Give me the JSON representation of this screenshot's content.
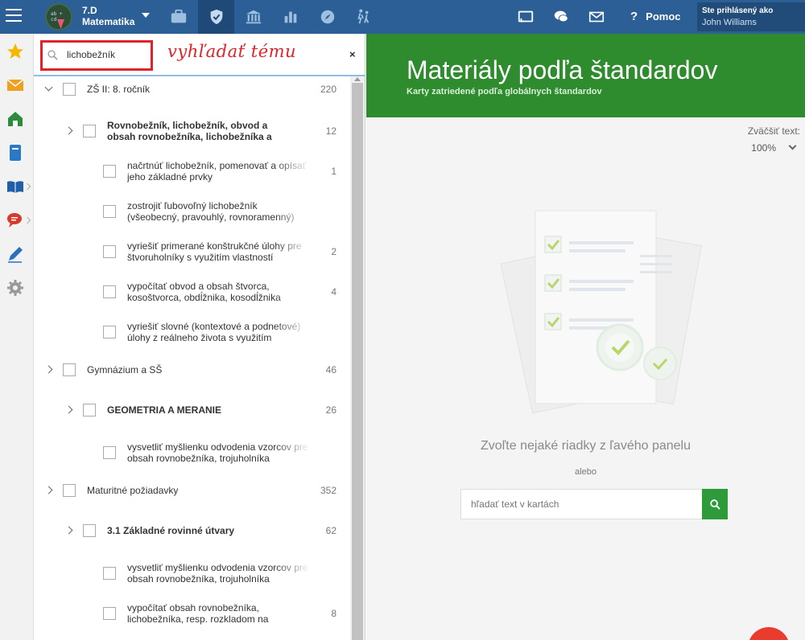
{
  "topbar": {
    "class_name": "7.D",
    "subject": "Matematika",
    "avatar_chalk": "ab + cd",
    "help_label": "Pomoc",
    "help_symbol": "?",
    "user_label": "Ste prihlásený ako",
    "user_name": "John Williams",
    "nav_icons": [
      "briefcase-icon",
      "shield-check-icon",
      "institution-icon",
      "bar-chart-icon",
      "compass-icon",
      "people-walking-icon"
    ],
    "active_nav": "shield-check-icon",
    "right_icons": [
      "cast-icon",
      "chat-icon",
      "mail-icon"
    ],
    "bar_color": "#2b5f95"
  },
  "sidebar": {
    "icons": [
      "star-icon",
      "envelope-icon",
      "home-icon",
      "notebook-icon",
      "open-book-icon",
      "speech-bubble-icon",
      "pencil-icon",
      "gear-icon"
    ]
  },
  "panel": {
    "search_value": "lichobežník",
    "annotation": "vyhľadať tému",
    "clear_symbol": "×",
    "tree": [
      {
        "label": "ZŠ II: 8. ročník",
        "count": "220",
        "level": 0,
        "bold": false,
        "chevron": "down"
      },
      {
        "label": "Rovnobežník, lichobežník, obvod a",
        "label2": "obsah rovnobežníka, lichobežníka a",
        "count": "12",
        "level": 1,
        "bold": true,
        "chevron": "right"
      },
      {
        "label": "načrtnúť lichobežník, pomenovať a opísať",
        "label2": "jeho základné prvky",
        "count": "1",
        "level": 2,
        "bold": false
      },
      {
        "label": "zostrojiť ľubovoľný lichobežník",
        "label2": "(všeobecný, pravouhlý, rovnoramenný)",
        "count": "",
        "level": 2,
        "bold": false
      },
      {
        "label": "vyriešiť primerané konštrukčné úlohy pre",
        "label2": "štvoruholníky s využitím vlastností",
        "count": "2",
        "level": 2,
        "bold": false
      },
      {
        "label": "vypočítať obvod a obsah štvorca,",
        "label2": "kosoštvorca, obdĺžnika, kosodĺžnika",
        "count": "4",
        "level": 2,
        "bold": false
      },
      {
        "label": "vyriešiť slovné (kontextové a podnetové)",
        "label2": "úlohy z reálneho života s využitím",
        "count": "",
        "level": 2,
        "bold": false
      },
      {
        "label": "Gymnázium a SŠ",
        "count": "46",
        "level": 0,
        "bold": false,
        "chevron": "right"
      },
      {
        "label": "GEOMETRIA A MERANIE",
        "count": "26",
        "level": 1,
        "bold": true,
        "chevron": "right"
      },
      {
        "label": "vysvetliť myšlienku odvodenia vzorcov pre",
        "label2": "obsah rovnobežníka, trojuholníka",
        "count": "",
        "level": 2,
        "bold": false
      },
      {
        "label": "Maturitné požiadavky",
        "count": "352",
        "level": 0,
        "bold": false,
        "chevron": "right"
      },
      {
        "label": "3.1 Základné rovinné útvary",
        "count": "62",
        "level": 1,
        "bold": true,
        "chevron": "right"
      },
      {
        "label": "vysvetliť myšlienku odvodenia vzorcov pre",
        "label2": "obsah rovnobežníka, trojuholníka",
        "count": "",
        "level": 2,
        "bold": false
      },
      {
        "label": "vypočítať obsah rovnobežníka,",
        "label2": "lichobežníka, resp. rozkladom na",
        "count": "8",
        "level": 2,
        "bold": false
      }
    ]
  },
  "content": {
    "title": "Materiály podľa štandardov",
    "subtitle": "Karty zatriedené podľa globálnych štandardov",
    "zoom_label": "Zväčšiť text:",
    "zoom_value": "100%",
    "empty_message": "Zvoľte nejaké riadky z ľavého panelu",
    "or_text": "alebo",
    "card_search_placeholder": "hľadať text v kartách",
    "accent_green": "#2e8b2e",
    "fab_color": "#ea3b2f"
  }
}
